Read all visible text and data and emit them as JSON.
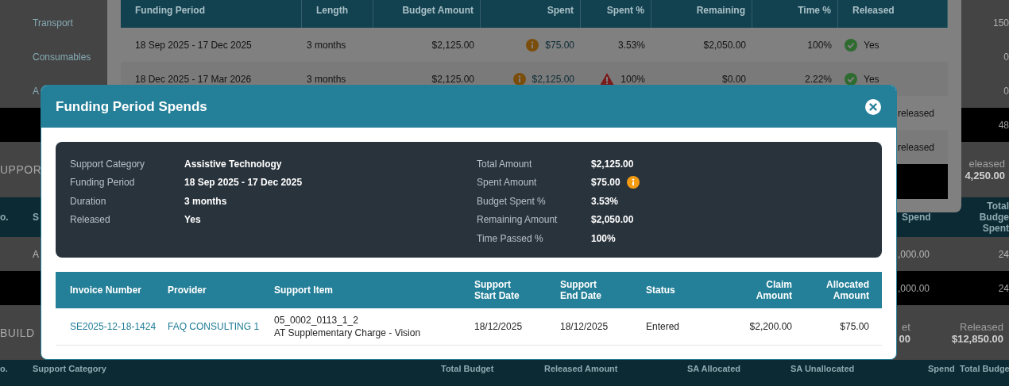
{
  "background_page": {
    "top_rows": [
      {
        "category": "Transport",
        "percent": "150"
      },
      {
        "category": "Consumables",
        "percent": "0"
      },
      {
        "category": "A",
        "percent": "0"
      }
    ],
    "top_total": {
      "percent": "48"
    },
    "section_1": {
      "heading": "UPPOR",
      "released_label": "eleased",
      "released_value": "4,250.00"
    },
    "section_1_header": {
      "column_1": "o.",
      "column_2": "S",
      "spend": "Spend",
      "total_budget_spent": [
        "Total Budge",
        "Spent"
      ]
    },
    "section_1_rows": [
      {
        "category": "A",
        "spend": ",000.00",
        "percent": "24"
      }
    ],
    "section_1_total": {
      "spend": ",000.00",
      "percent": "24"
    },
    "section_2": {
      "heading": "BUILD",
      "budget_label": "et",
      "budget_value": "00",
      "released_label": "Released",
      "released_value": "$12,850.00"
    },
    "section_2_header": [
      "o.",
      "Support Category",
      "Total Budget",
      "Released Amount",
      "SA Allocated",
      "SA Unallocated",
      "Spend",
      "Total Budge"
    ]
  },
  "periods_dialog": {
    "columns": [
      "Funding Period",
      "Length",
      "Budget Amount",
      "Spent",
      "Spent %",
      "Remaining",
      "Time %",
      "Released"
    ],
    "rows": [
      {
        "funding_period": "18 Sep 2025 - 17 Dec 2025",
        "length": "3 months",
        "budget_amount": "$2,125.00",
        "spent_info": true,
        "spent": "$75.00",
        "spent_warning": false,
        "spent_percent": "3.53%",
        "remaining": "$2,050.00",
        "time_percent": "100%",
        "released": true,
        "released_text": "Yes"
      },
      {
        "funding_period": "18 Dec 2025 - 17 Mar 2026",
        "length": "3 months",
        "budget_amount": "$2,125.00",
        "spent_info": true,
        "spent": "$2,125.00",
        "spent_warning": true,
        "spent_percent": "100%",
        "remaining": "$0.00",
        "time_percent": "2.22%",
        "released": true,
        "released_text": "Yes"
      }
    ],
    "partial_rows": [
      {
        "released_text": "released"
      },
      {
        "released_text": "released"
      }
    ]
  },
  "spends_dialog": {
    "title": "Funding Period Spends",
    "details_left": [
      {
        "label": "Support Category",
        "value": "Assistive Technology"
      },
      {
        "label": "Funding Period",
        "value": "18 Sep 2025 - 17 Dec 2025"
      },
      {
        "label": "Duration",
        "value": "3 months"
      },
      {
        "label": "Released",
        "value": "Yes"
      }
    ],
    "details_right": [
      {
        "label": "Total Amount",
        "value": "$2,125.00",
        "info": false
      },
      {
        "label": "Spent Amount",
        "value": "$75.00",
        "info": true
      },
      {
        "label": "Budget Spent %",
        "value": "3.53%",
        "info": false
      },
      {
        "label": "Remaining Amount",
        "value": "$2,050.00",
        "info": false
      },
      {
        "label": "Time Passed %",
        "value": "100%",
        "info": false
      }
    ],
    "table": {
      "columns": [
        "Invoice Number",
        "Provider",
        "Support Item",
        "Support Start Date",
        "Support End Date",
        "Status",
        "Claim Amount",
        "Allocated Amount"
      ],
      "rows": [
        {
          "invoice_number": "SE2025-12-18-1424",
          "provider": "FAQ CONSULTING 1",
          "support_item_code": "05_0002_0113_1_2",
          "support_item_name": "AT Supplementary Charge - Vision",
          "start_date": "18/12/2025",
          "end_date": "18/12/2025",
          "status": "Entered",
          "claim_amount": "$2,200.00",
          "allocated_amount": "$75.00"
        }
      ]
    }
  }
}
